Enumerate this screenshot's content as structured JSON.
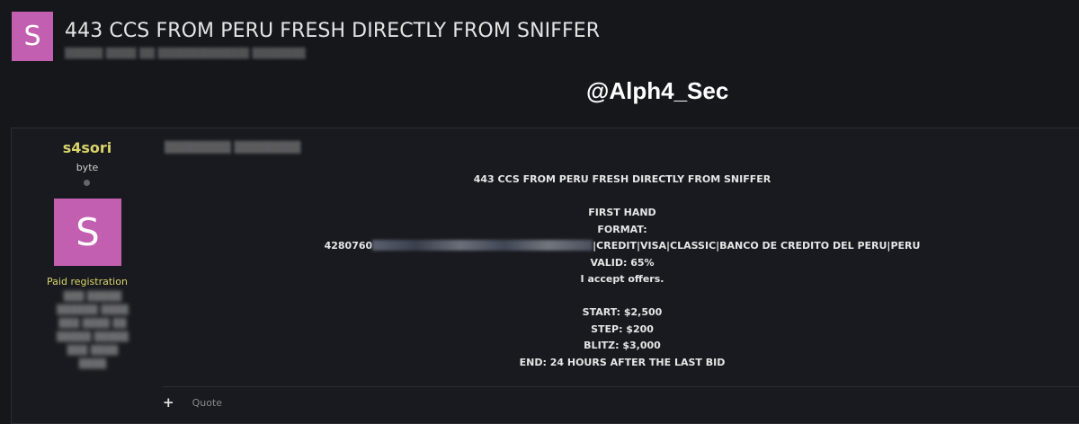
{
  "topic": {
    "avatar_letter": "S",
    "title": "443 CCS FROM PERU FRESH DIRECTLY FROM SNIFFER",
    "subtitle_blurred": "▒▒▒▒▒ ▒▒▒▒ ▒▒ ▒▒▒▒▒▒▒▒▒▒▒▒ ▒▒▒▒▒▒▒"
  },
  "watermark": "@Alph4_Sec",
  "author": {
    "name": "s4sori",
    "rank": "byte",
    "avatar_letter": "S",
    "group": "Paid registration",
    "meta_blurred": "▒▒▒ ▒▒▒▒▒ ▒▒▒▒▒▒ ▒▒▒▒ ▒▒▒ ▒▒▒▒ ▒▒ ▒▒▒▒▒ ▒▒▒▒▒ ▒▒▒ ▒▒▒▒ ▒▒▒▒"
  },
  "post": {
    "date_blurred": "▒▒▒▒▒▒▒▒ ▒▒▒▒▒▒▒▒",
    "heading": "443 CCS FROM PERU FRESH DIRECTLY FROM SNIFFER",
    "first_hand": "FIRST HAND",
    "format_label": "FORMAT:",
    "format_prefix": "4280760",
    "format_suffix": "|CREDIT|VISA|CLASSIC|BANCO DE CREDITO DEL PERU|PERU",
    "valid": "VALID: 65%",
    "offers": "I accept offers.",
    "start": "START: $2,500",
    "step": "STEP: $200",
    "blitz": "BLITZ: $3,000",
    "end": "END: 24 HOURS AFTER THE LAST BID"
  },
  "footer": {
    "plus_icon": "+",
    "quote_label": "Quote"
  },
  "colors": {
    "background": "#16171b",
    "avatar": "#c25fb0",
    "username": "#d9d46a"
  }
}
